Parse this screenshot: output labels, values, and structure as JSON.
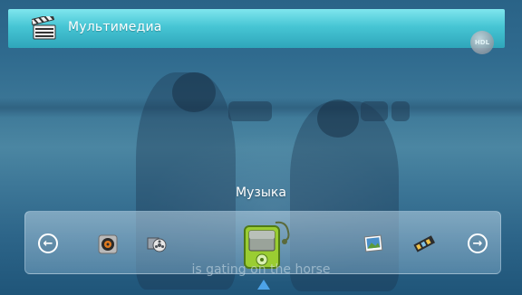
{
  "header": {
    "title": "Мультимедиа",
    "badge": "HDL",
    "icon": "clapperboard-icon"
  },
  "carousel": {
    "selected_label": "Музыка",
    "prev_glyph": "←",
    "next_glyph": "→",
    "items": [
      {
        "icon": "dvd-player-icon"
      },
      {
        "icon": "video-reel-icon"
      },
      {
        "icon": "music-player-icon",
        "selected": true
      },
      {
        "icon": "photo-icon"
      },
      {
        "icon": "film-strip-icon"
      }
    ]
  },
  "subtitle": "is gating on the horse",
  "colors": {
    "header_gradient_top": "#7fe6ee",
    "header_gradient_bottom": "#2fa6ba",
    "accent_arrow": "#4da3e8",
    "music_icon_green": "#9acd32"
  }
}
